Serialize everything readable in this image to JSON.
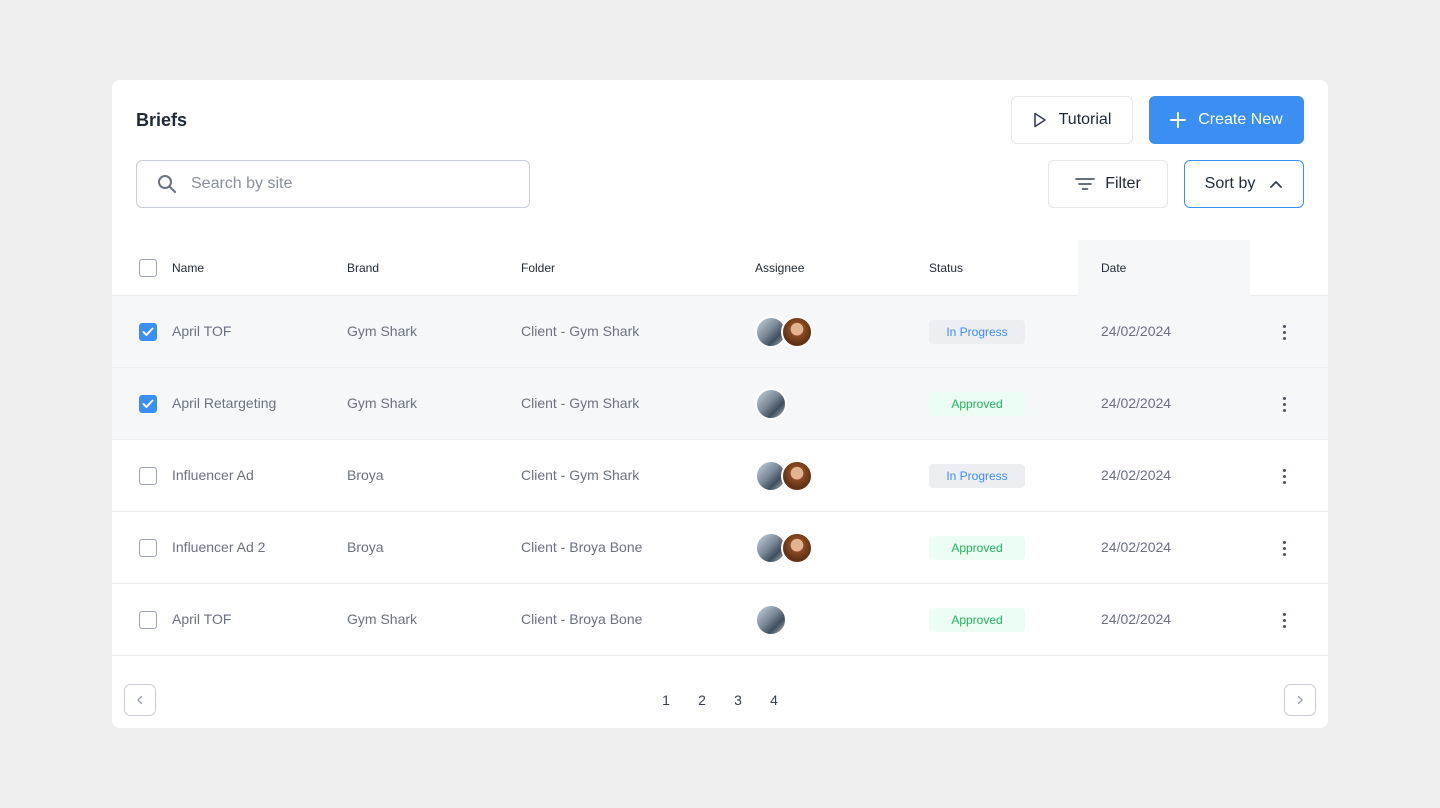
{
  "header": {
    "title": "Briefs",
    "tutorial_label": "Tutorial",
    "create_label": "Create New"
  },
  "toolbar": {
    "search_placeholder": "Search by site",
    "search_value": "",
    "filter_label": "Filter",
    "sort_label": "Sort by"
  },
  "table": {
    "columns": [
      "Name",
      "Brand",
      "Folder",
      "Assignee",
      "Status",
      "Date"
    ],
    "rows": [
      {
        "checked": true,
        "name": "April TOF",
        "brand": "Gym Shark",
        "folder": "Client - Gym Shark",
        "assignees": 2,
        "status": "In Progress",
        "date": "24/02/2024"
      },
      {
        "checked": true,
        "name": "April Retargeting",
        "brand": "Gym Shark",
        "folder": "Client - Gym Shark",
        "assignees": 1,
        "status": "Approved",
        "date": "24/02/2024"
      },
      {
        "checked": false,
        "name": "Influencer Ad",
        "brand": "Broya",
        "folder": "Client - Gym Shark",
        "assignees": 2,
        "status": "In Progress",
        "date": "24/02/2024"
      },
      {
        "checked": false,
        "name": "Influencer Ad 2",
        "brand": "Broya",
        "folder": "Client - Broya Bone",
        "assignees": 2,
        "status": "Approved",
        "date": "24/02/2024"
      },
      {
        "checked": false,
        "name": "April TOF",
        "brand": "Gym Shark",
        "folder": "Client - Broya Bone",
        "assignees": 1,
        "status": "Approved",
        "date": "24/02/2024"
      }
    ]
  },
  "pagination": {
    "pages": [
      "1",
      "2",
      "3",
      "4"
    ]
  },
  "colors": {
    "accent": "#3b8ff3",
    "approved_text": "#22b35e",
    "approved_bg": "#ecfdf3",
    "progress_bg": "#eceef1"
  },
  "icons": {
    "tutorial": "play-icon",
    "create": "plus-icon",
    "search": "search-icon",
    "filter": "filter-icon",
    "sort": "chevron-up-icon",
    "row_menu": "kebab-menu-icon",
    "prev": "chevron-left-icon",
    "next": "chevron-right-icon"
  }
}
